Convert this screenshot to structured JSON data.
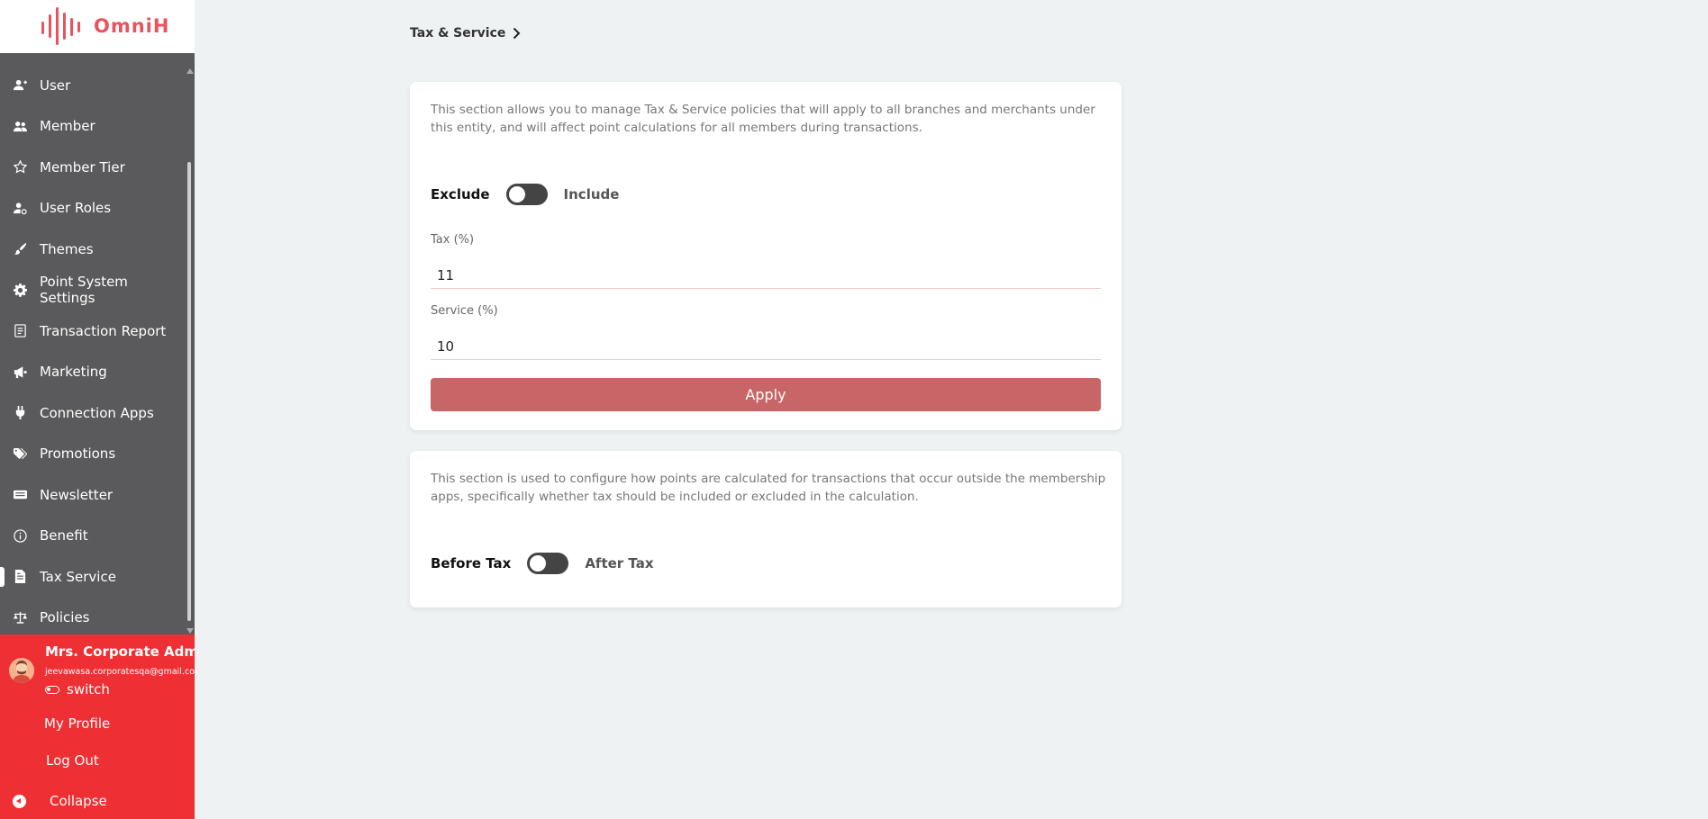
{
  "app": {
    "logo_text": "OmniH",
    "brand_color": "#e8535e",
    "accent_red": "#ee2f33"
  },
  "sidebar": {
    "items": [
      {
        "label": "User",
        "icon": "user-add-icon"
      },
      {
        "label": "Member",
        "icon": "users-icon"
      },
      {
        "label": "Member Tier",
        "icon": "star-icon"
      },
      {
        "label": "User Roles",
        "icon": "user-gear-icon"
      },
      {
        "label": "Themes",
        "icon": "brush-icon"
      },
      {
        "label": "Point System Settings",
        "icon": "gear-icon"
      },
      {
        "label": "Transaction Report",
        "icon": "report-icon"
      },
      {
        "label": "Marketing",
        "icon": "megaphone-icon"
      },
      {
        "label": "Connection Apps",
        "icon": "plug-icon"
      },
      {
        "label": "Promotions",
        "icon": "tags-icon"
      },
      {
        "label": "Newsletter",
        "icon": "newsletter-icon"
      },
      {
        "label": "Benefit",
        "icon": "info-icon"
      },
      {
        "label": "Tax Service",
        "icon": "document-icon",
        "active": true
      },
      {
        "label": "Policies",
        "icon": "scale-icon"
      }
    ]
  },
  "profile": {
    "name": "Mrs. Corporate Admin",
    "email": "jeevawasa.corporatesqa@gmail.com",
    "switch_label": "switch",
    "my_profile": "My Profile",
    "log_out": "Log Out",
    "collapse": "Collapse"
  },
  "breadcrumb": {
    "title": "Tax & Service"
  },
  "tax_card": {
    "description": "This section allows you to manage Tax & Service policies that will apply to all branches and merchants under this entity, and will affect point calculations for all members during transactions.",
    "toggle_left": "Exclude",
    "toggle_right": "Include",
    "tax_label": "Tax (%)",
    "tax_value": "11",
    "service_label": "Service (%)",
    "service_value": "10",
    "apply_label": "Apply"
  },
  "points_card": {
    "description": "This section is used to configure how points are calculated for transactions that occur outside the membership apps, specifically whether tax should be included or excluded in the calculation.",
    "toggle_left": "Before Tax",
    "toggle_right": "After Tax"
  }
}
